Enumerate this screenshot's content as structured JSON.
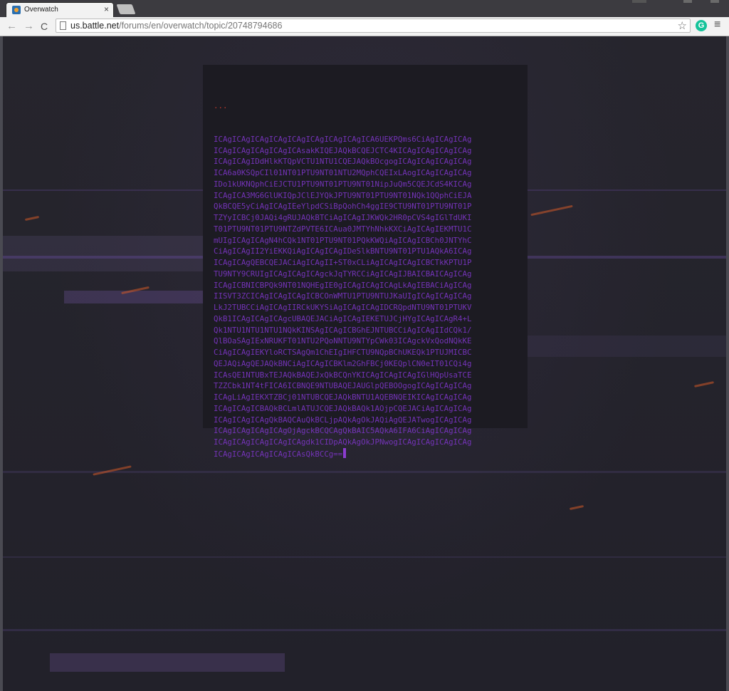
{
  "browser": {
    "tab_title": "Overwatch",
    "tab_close": "×",
    "nav_back": "←",
    "nav_forward": "→",
    "nav_reload": "C",
    "url_host": "us.battle.net",
    "url_path": "/forums/en/overwatch/topic/20748794686",
    "star": "☆",
    "extension_letter": "G",
    "menu": "≡"
  },
  "code": {
    "ellipsis": "...",
    "lines": [
      "ICAgICAgICAgICAgICAgICAgICAgICAgICA6UEKPQms6CiAgICAgICAg",
      "ICAgICAgICAgICAgICAsakKIQEJAQkBCQEJCTC4KICAgICAgICAgICAg",
      "ICAgICAgIDdHlkKTQpVCTU1NTU1CQEJAQkBOcgogICAgICAgICAgICAg",
      "ICA6a0KSQpCIl01NT01PTU9NT01NTU2MQphCQEIxLAogICAgICAgICAg",
      "IDo1kUKNQphCiEJCTU1PTU9NT01PTU9NT01NipJuQm5CQEJCdS4KICAg",
      "ICAgICA3MG6GlUKIQpJClEJYQkJPTU9NT01PTU9NT01NQk1QQphCiEJA",
      "QkBCQE5yCiAgICAgIEeYlpdCSiBpQohCh4ggIE9CTU9NT01PTU9NT01P",
      "TZYyICBCj0JAQi4gRUJAQkBTCiAgICAgIJKWQk2HR0pCVS4gIGlTdUKI",
      "T01PTU9NT01PTU9NTZdPVTE6ICAua0JMTYhNhkKXCiAgICAgIEKMTU1C",
      "mUIgICAgICAgN4hCQk1NT01PTU9NT01PQkKWQiAgICAgICBCh0JNTYhC",
      "CiAgICAgII2YiEKKQiAgICAgICAgIDeSlkBNTU9NT01PTU1AQkA6ICAg",
      "ICAgICAgQEBCQEJACiAgICAgII+ST0xCLiAgICAgICAgICBCTkKPTU1P",
      "TU9NTY9CRUIgICAgICAgICAgckJqTYRCCiAgICAgIJBAICBAICAgICAg",
      "ICAgICBNICBPQk9NT01NQHEgIE0gICAgICAgICAgLkAgIEBACiAgICAg",
      "IISVT3ZCICAgICAgICAgICBCOnWMTU1PTU9NTUJKaUIgICAgICAgICAg",
      "LkJ2TUBCCiAgICAgIIRCkUKYSiAgICAgICAgIDCRQpdNTU9NT01PTUKV",
      "QkB1ICAgICAgICAgcUBAQEJACiAgICAgIEKETUJCjHYgICAgICAgR4+L",
      "Qk1NTU1NTU1NTU1NQkKINSAgICAgICBGhEJNTUBCCiAgICAgIIdCQk1/",
      "QlBOaSAgIExNRUKFT01NTU2PQoNNTU9NTYpCWk03ICAgckVxQodNQkKE",
      "CiAgICAgIEKYloRCTSAgQm1ChEIgIHFCTU9NQpBChUKEQk1PTUJMICBC",
      "QEJAQiAgQEJAQkBNCiAgICAgICBKlm2GhFBCj0KEQplCN0eIT01CQi4g",
      "ICAsQE1NTUBxTEJAQkBAQEJxQkBCQnYKICAgICAgICAgIGlHQpUsaTCE",
      "TZZCbk1NT4tFICA6ICBNQE9NTUBAQEJAUGlpQEBOOgogICAgICAgICAg",
      "ICAgLiAgIEKXTZBCj01NTUBCQEJAQkBNTU1AQEBNQEIKICAgICAgICAg",
      "ICAgICAgICBAQkBCLmlATUJCQEJAQkBAQk1AOjpCQEJACiAgICAgICAg",
      "ICAgICAgICAgQkBAQCAuQkBCLjpAQkAgOkJAQiAgQEJATwogICAgICAg",
      "ICAgICAgICAgICAgOjAgckBCQCAgQkBAIC5AQkA6IFA6CiAgICAgICAg",
      "ICAgICAgICAgICAgICAgdk1CIDpAQkAgOkJPNwogICAgICAgICAgICAg",
      "ICAgICAgICAgICAgICAsQkBCCg=="
    ]
  }
}
